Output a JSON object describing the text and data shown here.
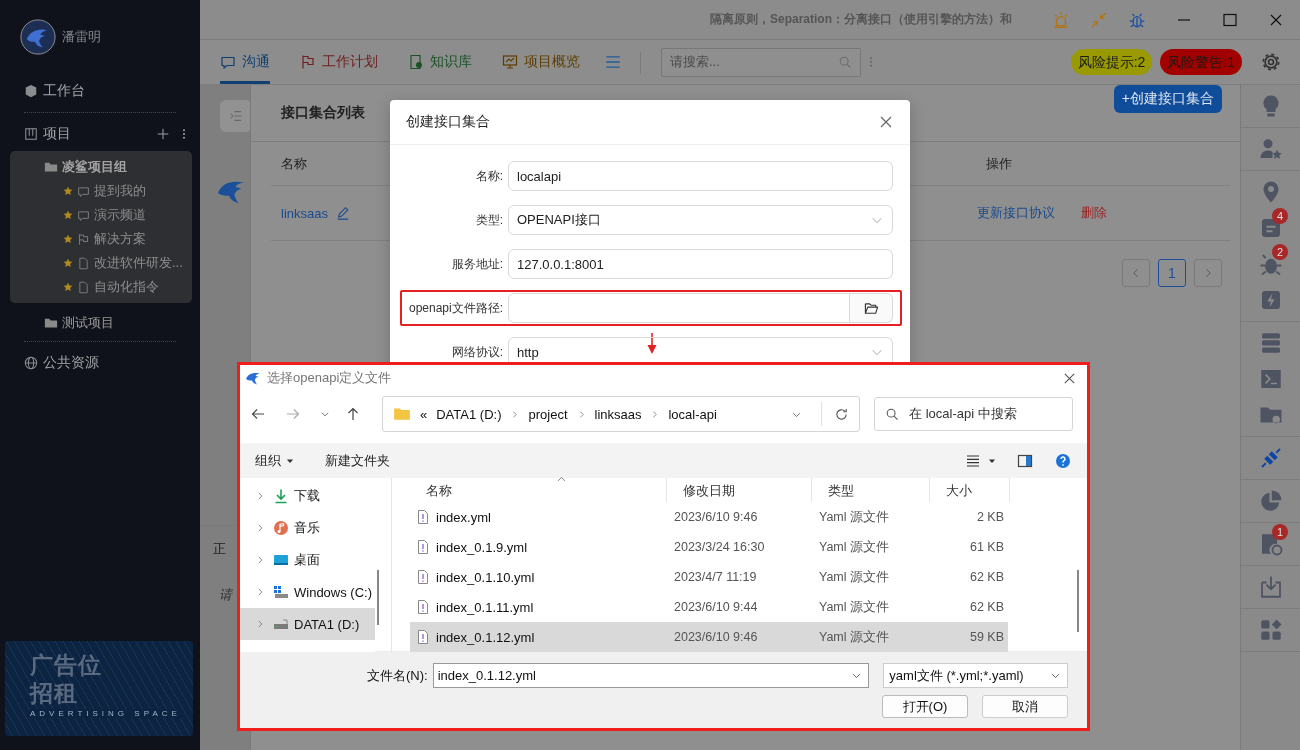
{
  "sidebar": {
    "user": {
      "name": "潘雷明"
    },
    "workbench": {
      "label": "工作台"
    },
    "projects": {
      "label": "项目",
      "children": [
        {
          "label": "凌鲨项目组",
          "expanded": true,
          "children": [
            {
              "label": "提到我的",
              "kind": "chat",
              "starred": true
            },
            {
              "label": "演示频道",
              "kind": "chat",
              "starred": true
            },
            {
              "label": "解决方案",
              "kind": "flag",
              "starred": true
            },
            {
              "label": "改进软件研发...",
              "kind": "doc",
              "starred": true
            },
            {
              "label": "自动化指令",
              "kind": "doc",
              "starred": true
            }
          ]
        },
        {
          "label": "测试项目",
          "expanded": false
        }
      ]
    },
    "public": {
      "label": "公共资源"
    },
    "ad": {
      "title": "广告位",
      "subtitle": "招租",
      "caption": "ADVERTISING SPACE"
    }
  },
  "title_bar": {
    "title": "隔离原则，Separation：分离接口（使用引擎的方法）和"
  },
  "tabs": [
    {
      "label": "沟通",
      "kind": "chat",
      "color": "#123f73",
      "selected": true
    },
    {
      "label": "工作计划",
      "kind": "flag",
      "color": "#6e1f1f",
      "selected": false
    },
    {
      "label": "知识库",
      "kind": "kb",
      "color": "#1d5228",
      "selected": false
    },
    {
      "label": "项目概览",
      "kind": "overview",
      "color": "#5e3e00",
      "selected": false
    }
  ],
  "search": {
    "placeholder": "请搜索..."
  },
  "risk_badges": [
    {
      "label": "风险提示:2",
      "color": "#999900"
    },
    {
      "label": "风险警告:1",
      "color": "#a30000"
    }
  ],
  "editor": {
    "tab": "正",
    "placeholder": "请"
  },
  "list_panel": {
    "title": "接口集合列表",
    "create_button": "+创建接口集合",
    "columns": [
      "名称",
      "操作"
    ],
    "rows": [
      {
        "name": "linksaas",
        "actions": [
          {
            "label": "更新接口协议",
            "kind": "link"
          },
          {
            "label": "删除",
            "kind": "danger"
          }
        ]
      }
    ],
    "pages": [
      {
        "label": "1",
        "selected": true
      }
    ]
  },
  "create_dialog": {
    "title": "创建接口集合",
    "fields": [
      {
        "label": "名称:",
        "kind": "text",
        "value": "localapi",
        "highlighted": false
      },
      {
        "label": "类型:",
        "kind": "select",
        "value": "OPENAPI接口",
        "highlighted": false
      },
      {
        "label": "服务地址:",
        "kind": "text",
        "value": "127.0.0.1:8001",
        "highlighted": false
      },
      {
        "label": "openapi文件路径:",
        "kind": "file",
        "highlighted": true
      },
      {
        "label": "网络协议:",
        "kind": "select",
        "value": "http",
        "highlighted": false
      }
    ]
  },
  "file_dialog": {
    "title": "选择openapi定义文件",
    "path": [
      "«",
      "DATA1 (D:)",
      "project",
      "linksaas",
      "local-api"
    ],
    "search_placeholder": "在 local-api 中搜索",
    "toolbar": {
      "organize": "组织",
      "new_folder": "新建文件夹"
    },
    "tree": [
      {
        "label": "下载",
        "kind": "download",
        "selected": false
      },
      {
        "label": "音乐",
        "kind": "music",
        "selected": false
      },
      {
        "label": "桌面",
        "kind": "desktop",
        "selected": false
      },
      {
        "label": "Windows (C:)",
        "kind": "drive_windows",
        "selected": false
      },
      {
        "label": "DATA1 (D:)",
        "kind": "drive",
        "selected": true
      }
    ],
    "columns": [
      "名称",
      "修改日期",
      "类型",
      "大小"
    ],
    "files": [
      {
        "name": "index.yml",
        "date": "2023/6/10 9:46",
        "type": "Yaml 源文件",
        "size": "2 KB",
        "selected": false
      },
      {
        "name": "index_0.1.9.yml",
        "date": "2023/3/24 16:30",
        "type": "Yaml 源文件",
        "size": "61 KB",
        "selected": false
      },
      {
        "name": "index_0.1.10.yml",
        "date": "2023/4/7 11:19",
        "type": "Yaml 源文件",
        "size": "62 KB",
        "selected": false
      },
      {
        "name": "index_0.1.11.yml",
        "date": "2023/6/10 9:44",
        "type": "Yaml 源文件",
        "size": "62 KB",
        "selected": false
      },
      {
        "name": "index_0.1.12.yml",
        "date": "2023/6/10 9:46",
        "type": "Yaml 源文件",
        "size": "59 KB",
        "selected": true
      }
    ],
    "filename_label": "文件名(N):",
    "filename": "index_0.1.12.yml",
    "filter": "yaml文件 (*.yml;*.yaml)",
    "buttons": [
      "打开(O)",
      "取消"
    ]
  },
  "right_toolbar": {
    "groups": [
      {
        "items": [
          {
            "kind": "lightbulb",
            "selected": false
          }
        ]
      },
      {
        "items": [
          {
            "kind": "user_star",
            "selected": false
          }
        ]
      },
      {
        "items": [
          {
            "kind": "map_pin",
            "selected": false
          },
          {
            "kind": "note",
            "selected": false,
            "badge": "4"
          },
          {
            "kind": "bug",
            "selected": false,
            "badge": "2"
          },
          {
            "kind": "bolt",
            "selected": false
          }
        ]
      },
      {
        "items": [
          {
            "kind": "server",
            "selected": false
          },
          {
            "kind": "terminal",
            "selected": false
          },
          {
            "kind": "folder_gear",
            "selected": false
          }
        ]
      },
      {
        "items": [
          {
            "kind": "plug",
            "selected": true
          }
        ]
      },
      {
        "items": [
          {
            "kind": "pie_chart",
            "selected": false
          }
        ]
      },
      {
        "items": [
          {
            "kind": "doc_clock",
            "selected": false,
            "badge": "1"
          }
        ]
      },
      {
        "items": [
          {
            "kind": "download_box",
            "selected": false
          }
        ]
      },
      {
        "items": [
          {
            "kind": "apps",
            "selected": false
          }
        ]
      }
    ]
  }
}
